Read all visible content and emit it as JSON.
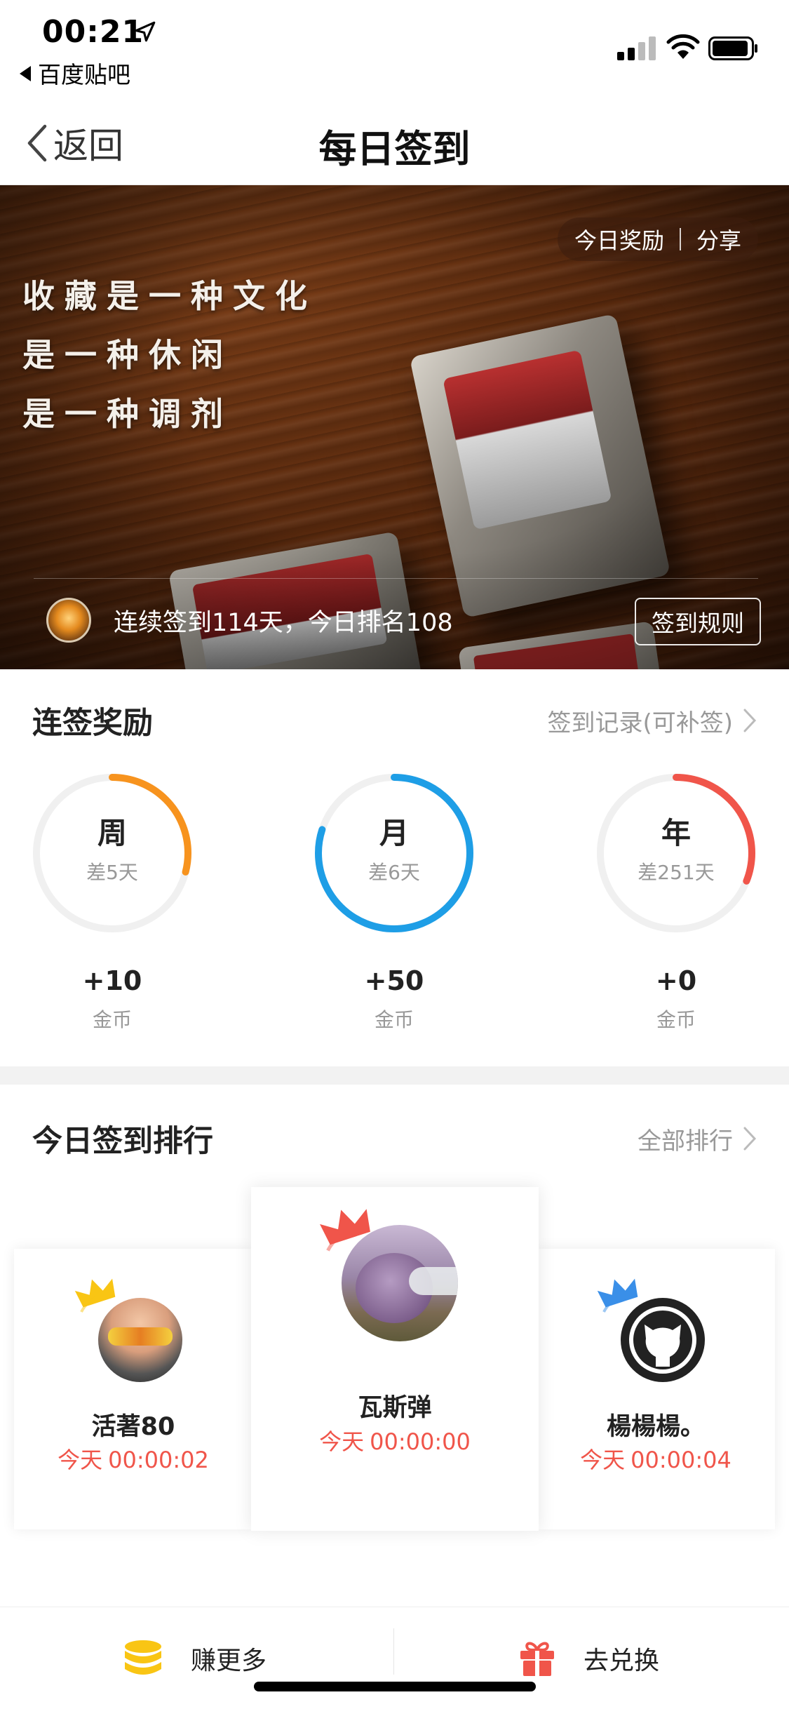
{
  "status_bar": {
    "time": "00:21",
    "back_app": "百度贴吧"
  },
  "nav": {
    "back_label": "返回",
    "title": "每日签到"
  },
  "banner": {
    "actions": [
      "今日奖励",
      "分享"
    ],
    "quote_lines": [
      "收藏是一种文化",
      "是一种休闲",
      "是一种调剂"
    ],
    "streak_text": "连续签到114天，今日排名108",
    "rules_button": "签到规则"
  },
  "rewards": {
    "title": "连签奖励",
    "record_link": "签到记录(可补签)",
    "items": [
      {
        "label": "周",
        "remaining": "差5天",
        "amount": "+10",
        "unit": "金币",
        "progress": 0.29,
        "color": "#f7931e"
      },
      {
        "label": "月",
        "remaining": "差6天",
        "amount": "+50",
        "unit": "金币",
        "progress": 0.8,
        "color": "#1e9ee6"
      },
      {
        "label": "年",
        "remaining": "差251天",
        "amount": "+0",
        "unit": "金币",
        "progress": 0.31,
        "color": "#f0554a"
      }
    ]
  },
  "ranking": {
    "title": "今日签到排行",
    "all_link": "全部排行",
    "entries": [
      {
        "name": "瓦斯弹",
        "day": "今天",
        "time": "00:00:00",
        "crown_color": "#f0554a"
      },
      {
        "name": "活著80",
        "day": "今天",
        "time": "00:00:02",
        "crown_color": "#f9c514"
      },
      {
        "name": "楊楊楊。",
        "day": "今天",
        "time": "00:00:04",
        "crown_color": "#3a8fe8"
      }
    ]
  },
  "bottom_bar": {
    "earn_more": "赚更多",
    "redeem": "去兑换",
    "accent": "#f9c514",
    "gift_color": "#f0554a"
  }
}
